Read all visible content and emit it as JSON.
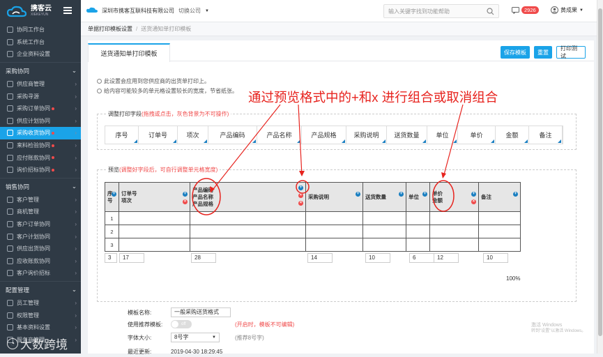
{
  "brand": {
    "name": "携客云",
    "sub": "XIEKEYUN"
  },
  "sidebar": {
    "top_items": [
      "协同工作台",
      "系统工作台",
      "企业资料设置"
    ],
    "groups": [
      {
        "label": "采购协同",
        "items": [
          {
            "label": "供应商管理",
            "dot": false
          },
          {
            "label": "采购寻源",
            "dot": false
          },
          {
            "label": "采购订单协同",
            "dot": true
          },
          {
            "label": "供应计划协同",
            "dot": false
          },
          {
            "label": "采购收货协同",
            "dot": true,
            "active": true
          },
          {
            "label": "来料检验协同",
            "dot": true
          },
          {
            "label": "应付账款协同",
            "dot": true
          },
          {
            "label": "询价招标协同",
            "dot": true
          }
        ]
      },
      {
        "label": "销售协同",
        "items": [
          {
            "label": "客户管理",
            "dot": false
          },
          {
            "label": "商机管理",
            "dot": false
          },
          {
            "label": "客户订单协同",
            "dot": false
          },
          {
            "label": "客户计划协同",
            "dot": false
          },
          {
            "label": "供应出货协同",
            "dot": false
          },
          {
            "label": "应收账款协同",
            "dot": false
          },
          {
            "label": "客户询价招标",
            "dot": false
          }
        ]
      },
      {
        "label": "配置管理",
        "items": [
          {
            "label": "员工管理",
            "dot": false
          },
          {
            "label": "权限管理",
            "dot": false
          },
          {
            "label": "基本资料设置",
            "dot": false
          },
          {
            "label": "服务商管理",
            "dot": false
          }
        ]
      }
    ]
  },
  "topbar": {
    "company": "深圳市携客互联科技有限公司",
    "switch_company": "切换公司",
    "search_placeholder": "输入关键字找到功能帮助",
    "message_count": "2926",
    "user": "黄成果"
  },
  "breadcrumb": {
    "parent": "单据打印模板设置",
    "current": "送货通知单打印模板"
  },
  "tab": {
    "label": "送货通知单打印模板"
  },
  "toolbar": {
    "save": "保存模板",
    "reset": "重置",
    "print_test": "打印测试"
  },
  "notes": [
    "此设置会应用到您供应商的出货单打印上。",
    "给内容可能较多的单元格设置较长的宽度，节省纸张。"
  ],
  "annotation": "通过预览格式中的+和x 进行组合或取消组合",
  "adjust": {
    "legend": "调整打印字段",
    "hint": "(拖拽或点击，灰色背景为不可操作)",
    "fields": [
      "序号",
      "订单号",
      "项次",
      "产品编码",
      "产品名称",
      "产品规格",
      "采购说明",
      "送货数量",
      "单位",
      "单价",
      "金额",
      "备注"
    ]
  },
  "preview": {
    "legend": "预览",
    "hint": "(调整好字段后，可自行调整单元格宽度)",
    "columns": [
      {
        "label": "序号"
      },
      {
        "label": "订单号 项次"
      },
      {
        "label": "产品编码 产品名称 产品规格"
      },
      {
        "label": "采购说明"
      },
      {
        "label": "送货数量"
      },
      {
        "label": "单位"
      },
      {
        "label": "单价 金额"
      },
      {
        "label": "备注"
      }
    ],
    "rows": [
      "1",
      "2",
      "3"
    ],
    "widths": [
      "3",
      "17",
      "28",
      "14",
      "10",
      "6",
      "12",
      "10"
    ],
    "total": "100%"
  },
  "form": {
    "name_label": "模板名称:",
    "name_value": "一般采购送货格式",
    "recommend_label": "使用推荐模板:",
    "recommend_state": "off",
    "recommend_hint": "(开启时，模板不可编辑)",
    "font_label": "字体大小:",
    "font_value": "8号字",
    "font_hint": "(推荐8号字)",
    "update_label": "最近更新:",
    "update_value": "2019-04-30 18:29:45"
  },
  "watermark": {
    "text": "大数跨境",
    "activate_title": "激活 Windows",
    "activate_sub": "转到\"设置\"以激活 Windows。"
  },
  "colors": {
    "accent": "#1aa3e8",
    "sidebar": "#2f3a45",
    "annotation": "#e7231e",
    "danger": "#f04b4b"
  }
}
